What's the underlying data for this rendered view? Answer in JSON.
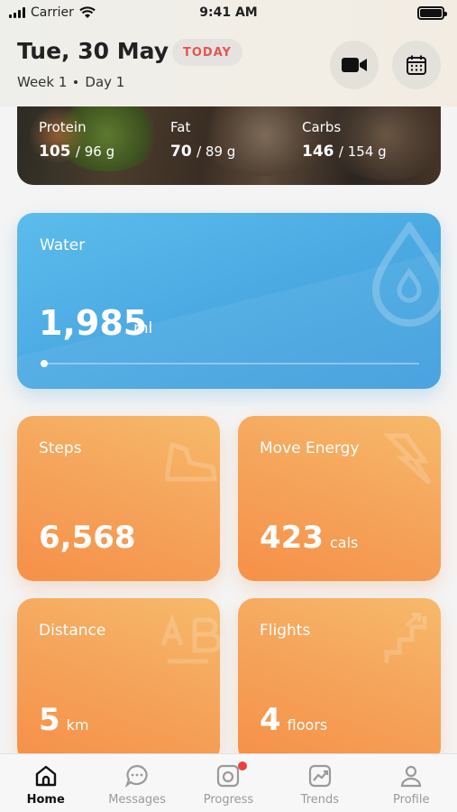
{
  "status_bar": {
    "carrier": "Carrier",
    "time": "9:41 AM"
  },
  "header": {
    "date": "Tue, 30 May",
    "today_badge": "TODAY",
    "week": "Week 1",
    "day": "Day 1",
    "video_icon": "video-camera-icon",
    "calendar_icon": "calendar-icon"
  },
  "macros": [
    {
      "label": "Protein",
      "value": "105",
      "target": "/ 96 g"
    },
    {
      "label": "Fat",
      "value": "70",
      "target": "/ 89 g"
    },
    {
      "label": "Carbs",
      "value": "146",
      "target": "/ 154 g"
    }
  ],
  "water": {
    "title": "Water",
    "value": "1,985",
    "unit": "ml",
    "progress": 0.01,
    "color": "#4aa8e2"
  },
  "tiles": [
    {
      "title": "Steps",
      "value": "6,568",
      "unit": "",
      "icon": "shoe-icon"
    },
    {
      "title": "Move Energy",
      "value": "423",
      "unit": "cals",
      "icon": "lightning-icon"
    },
    {
      "title": "Distance",
      "value": "5",
      "unit": "km",
      "icon": "a-to-b-icon"
    },
    {
      "title": "Flights",
      "value": "4",
      "unit": "floors",
      "icon": "stairs-icon"
    }
  ],
  "tabs": [
    {
      "label": "Home",
      "icon": "home-icon",
      "active": true
    },
    {
      "label": "Messages",
      "icon": "chat-icon"
    },
    {
      "label": "Progress",
      "icon": "progress-photo-icon",
      "badge": true
    },
    {
      "label": "Trends",
      "icon": "trends-icon"
    },
    {
      "label": "Profile",
      "icon": "profile-icon"
    }
  ],
  "colors": {
    "accent_orange": "#f5a35a",
    "water_blue": "#4aa8e2",
    "today_red": "#e25656"
  }
}
